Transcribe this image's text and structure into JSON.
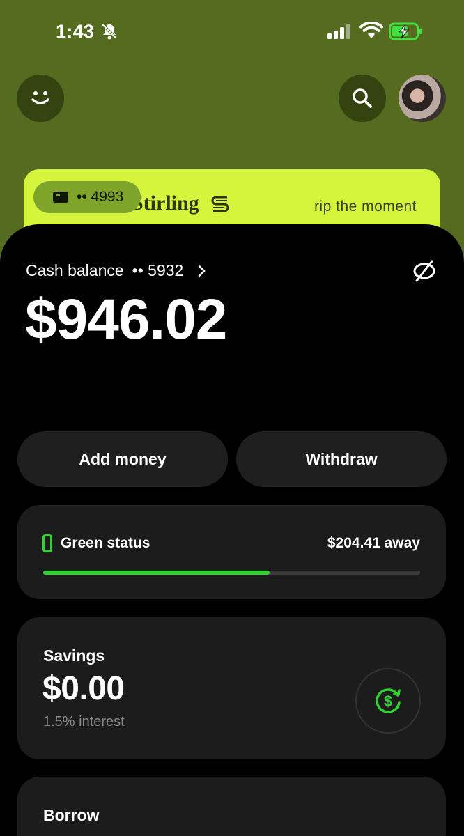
{
  "status_bar": {
    "time": "1:43"
  },
  "card": {
    "brand": "Stirling",
    "tagline": "rip the moment",
    "card_last4": "•• 4993"
  },
  "balance": {
    "label": "Cash balance",
    "account_last4": "•• 5932",
    "amount": "$946.02"
  },
  "actions": {
    "add_money": "Add money",
    "withdraw": "Withdraw"
  },
  "green_status": {
    "label": "Green status",
    "away": "$204.41 away",
    "progress": 0.6,
    "accent": "#2fd52f"
  },
  "savings": {
    "label": "Savings",
    "amount": "$0.00",
    "interest": "1.5% interest"
  },
  "borrow": {
    "label": "Borrow"
  },
  "colors": {
    "background": "#556b1f",
    "card": "#d4f53c",
    "sheet": "#000000",
    "panel": "#1c1c1c"
  }
}
